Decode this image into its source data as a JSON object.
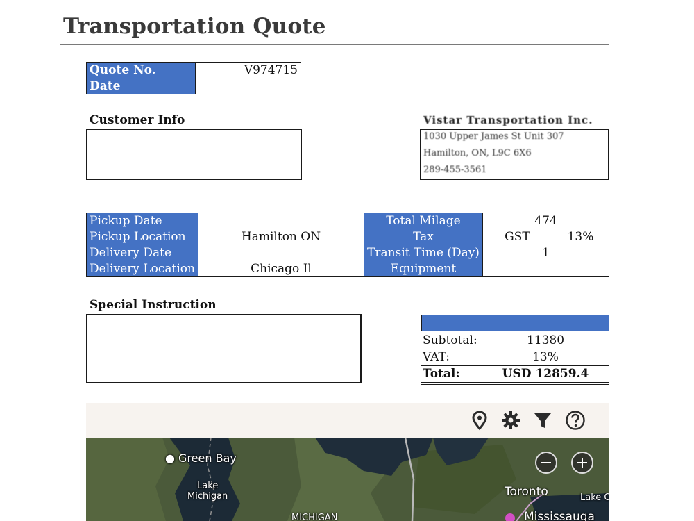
{
  "document": {
    "title": "Transportation Quote"
  },
  "quote": {
    "number_label": "Quote No.",
    "number_value": "V974715",
    "date_label": "Date",
    "date_value": ""
  },
  "customer": {
    "label": "Customer Info"
  },
  "vendor": {
    "name": "Vistar Transportation Inc.",
    "address_line1": "1030 Upper James St Unit 307",
    "address_line2": "Hamilton, ON, L9C 6X6",
    "phone": "289-455-3561"
  },
  "shipment": {
    "left_rows": [
      {
        "label": "Pickup Date",
        "value": ""
      },
      {
        "label": "Pickup Location",
        "value": "Hamilton ON"
      },
      {
        "label": "Delivery Date",
        "value": ""
      },
      {
        "label": "Delivery Location",
        "value": "Chicago Il"
      }
    ],
    "total_milage_label": "Total Milage",
    "total_milage_value": "474",
    "tax_label": "Tax",
    "tax_type": "GST",
    "tax_rate": "13%",
    "transit_label": "Transit Time (Day)",
    "transit_value": "1",
    "equipment_label": "Equipment",
    "equipment_value": ""
  },
  "special": {
    "label": "Special Instruction"
  },
  "totals": {
    "subtotal_label": "Subtotal:",
    "subtotal_value": "11380",
    "vat_label": "VAT:",
    "vat_value": "13%",
    "total_label": "Total:",
    "total_value": "USD 12859.4"
  },
  "map": {
    "labels": {
      "green_bay": "Green Bay",
      "lake_michigan_1": "Lake",
      "lake_michigan_2": "Michigan",
      "toronto": "Toronto",
      "mississauga": "Mississauga",
      "lake_ontario": "Lake O",
      "michigan": "MICHIGAN"
    },
    "icons": [
      "location-pin-icon",
      "gear-icon",
      "filter-icon",
      "help-icon"
    ],
    "colors": {
      "toolbar": "#f7f3ef",
      "water": "#1c2a36",
      "land": "#4b5a3a"
    }
  },
  "colors": {
    "accent": "#4472c4"
  }
}
